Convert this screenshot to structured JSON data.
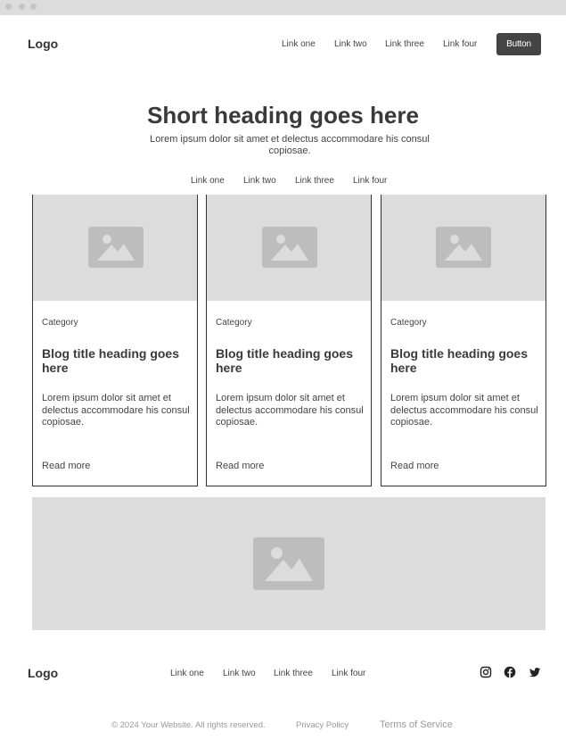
{
  "header": {
    "logo": "Logo",
    "nav": [
      "Link one",
      "Link two",
      "Link three",
      "Link four"
    ],
    "button": "Button"
  },
  "hero": {
    "title": "Short heading goes here",
    "subtitle": "Lorem ipsum dolor sit amet et delectus accommodare his consul copiosae.",
    "filters": [
      "Link one",
      "Link two",
      "Link three",
      "Link four"
    ]
  },
  "cards": [
    {
      "image": "image-placeholder-icon",
      "category": "Category",
      "title": "Blog title heading goes here",
      "description": "Lorem ipsum dolor sit amet et delectus accommodare his consul copiosae.",
      "link": "Read more"
    },
    {
      "image": "image-placeholder-icon",
      "category": "Category",
      "title": "Blog title heading goes here",
      "description": "Lorem ipsum dolor sit amet et delectus accommodare his consul copiosae.",
      "link": "Read more"
    },
    {
      "image": "image-placeholder-icon",
      "category": "Category",
      "title": "Blog title heading goes here",
      "description": "Lorem ipsum dolor sit amet et delectus accommodare his consul copiosae.",
      "link": "Read more"
    }
  ],
  "banner": {
    "image": "image-placeholder-icon"
  },
  "footer": {
    "logo": "Logo",
    "nav": [
      "Link one",
      "Link two",
      "Link three",
      "Link four"
    ],
    "social": [
      "instagram-icon",
      "facebook-icon",
      "twitter-icon"
    ],
    "copyright": "© 2024 Your Website. All rights reserved.",
    "privacy": "Privacy Policy",
    "terms": "Terms of Service"
  },
  "colors": {
    "placeholder": "#dcdcdc",
    "icon": "#bdbdbd",
    "button": "#444444",
    "text": "#333333"
  }
}
